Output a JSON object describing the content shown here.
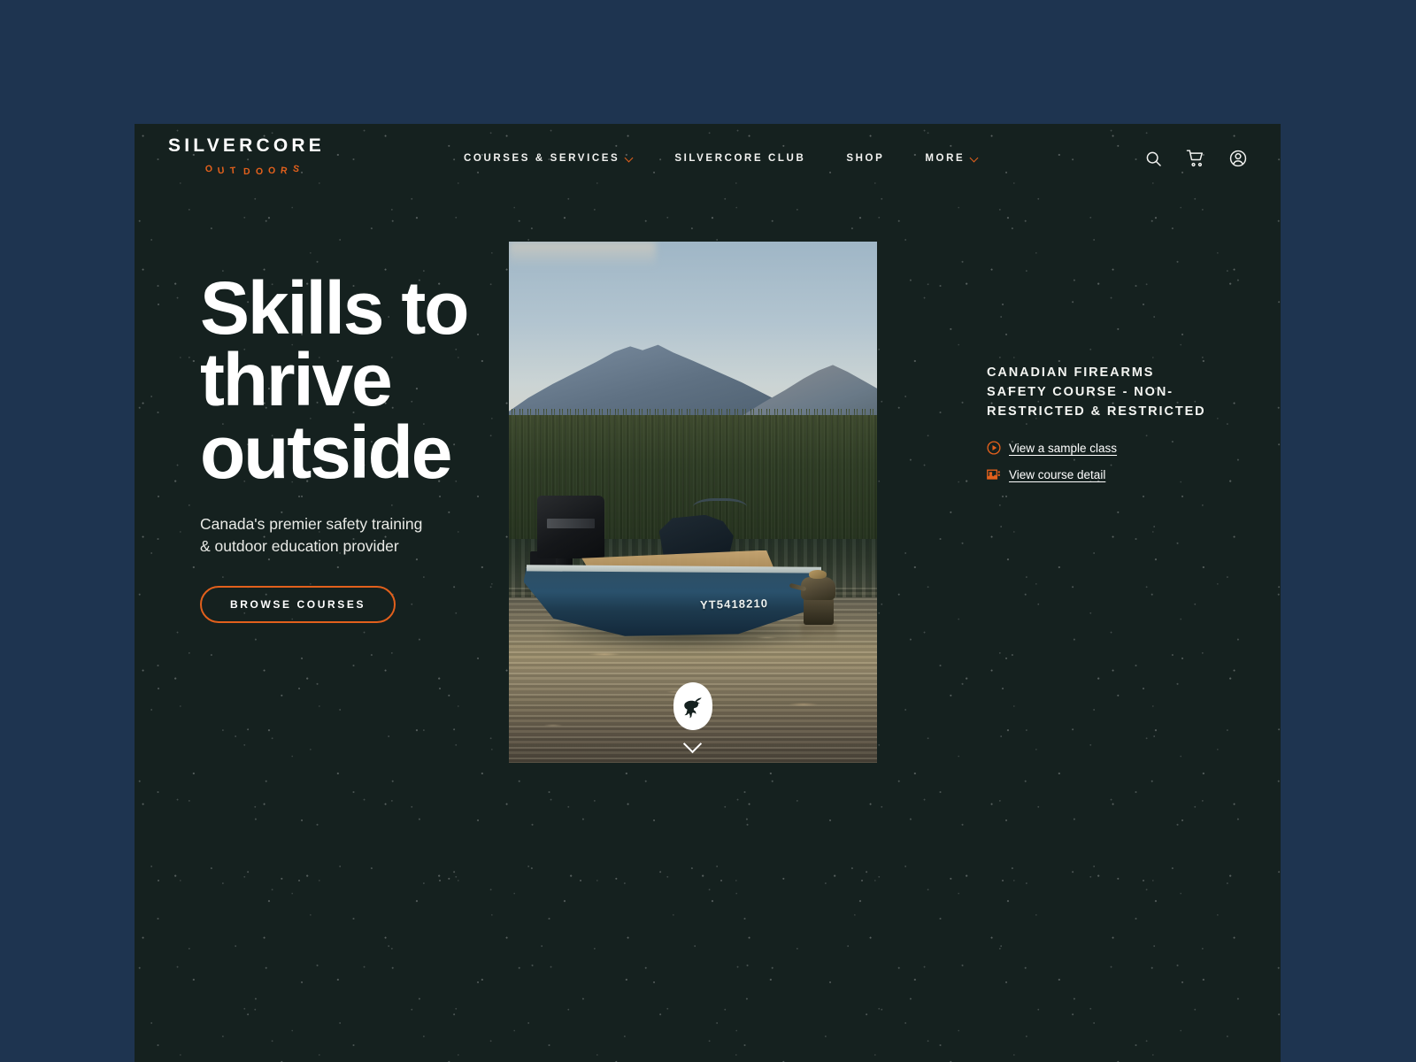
{
  "theme": {
    "page_background": "#1e3450",
    "panel_background": "#15211f",
    "accent_orange": "#e2601c",
    "text_primary": "#ffffff"
  },
  "header": {
    "logo": {
      "wordmark": "SILVERCORE",
      "tagline": "OUTDOORS"
    },
    "nav": [
      {
        "label": "COURSES & SERVICES",
        "has_dropdown": true
      },
      {
        "label": "SILVERCORE CLUB",
        "has_dropdown": false
      },
      {
        "label": "SHOP",
        "has_dropdown": false
      },
      {
        "label": "MORE",
        "has_dropdown": true
      }
    ],
    "actions": [
      {
        "icon": "search-icon",
        "label": "Search"
      },
      {
        "icon": "cart-icon",
        "label": "Cart"
      },
      {
        "icon": "account-icon",
        "label": "Account"
      }
    ]
  },
  "hero": {
    "heading": "Skills to\nthrive\noutside",
    "subheading": "Canada's premier safety training\n& outdoor education provider",
    "cta_label": "BROWSE COURSES",
    "photo": {
      "boat_registration": "YT5418210",
      "scroll_hint_icon": "chevron-down-icon",
      "badge_icon": "mountain-goat-badge-icon"
    }
  },
  "course_card": {
    "title": "CANADIAN FIREARMS SAFETY COURSE - NON-RESTRICTED & RESTRICTED",
    "links": [
      {
        "label": "View a sample class",
        "icon": "play-circle-icon"
      },
      {
        "label": "View course detail",
        "icon": "course-detail-icon"
      }
    ]
  }
}
